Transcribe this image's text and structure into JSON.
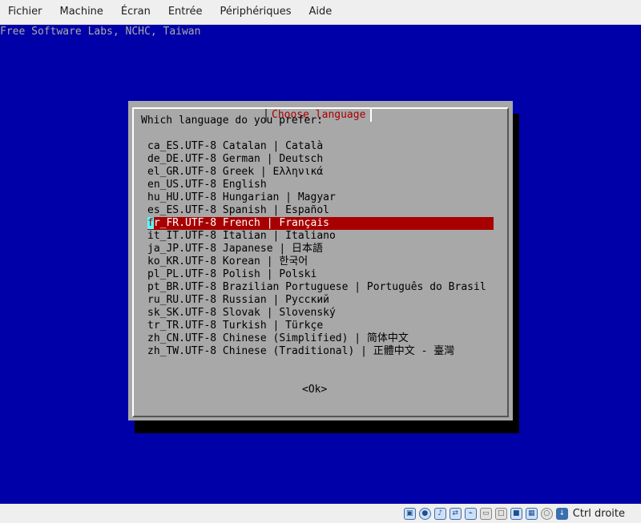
{
  "menubar": {
    "items": [
      "Fichier",
      "Machine",
      "Écran",
      "Entrée",
      "Périphériques",
      "Aide"
    ]
  },
  "screen": {
    "banner": "Free Software Labs, NCHC, Taiwan",
    "dialog": {
      "title": "Choose language",
      "prompt": "Which language do you prefer:",
      "items": [
        "ca_ES.UTF-8 Catalan | Català",
        "de_DE.UTF-8 German | Deutsch",
        "el_GR.UTF-8 Greek | Ελληνικά",
        "en_US.UTF-8 English",
        "hu_HU.UTF-8 Hungarian | Magyar",
        "es_ES.UTF-8 Spanish | Español",
        "fr_FR.UTF-8 French | Français",
        "it_IT.UTF-8 Italian | Italiano",
        "ja_JP.UTF-8 Japanese | 日本語",
        "ko_KR.UTF-8 Korean | 한국어",
        "pl_PL.UTF-8 Polish | Polski",
        "pt_BR.UTF-8 Brazilian Portuguese | Português do Brasil",
        "ru_RU.UTF-8 Russian | Русский",
        "sk_SK.UTF-8 Slovak | Slovenský",
        "tr_TR.UTF-8 Turkish | Türkçe",
        "zh_CN.UTF-8 Chinese (Simplified) | 简体中文",
        "zh_TW.UTF-8 Chinese (Traditional) | 正體中文 - 臺灣"
      ],
      "selected_index": 6,
      "ok_label": "<Ok>"
    }
  },
  "statusbar": {
    "icons": [
      "hard-disk-icon",
      "optical-drive-icon",
      "audio-icon",
      "network-icon",
      "usb-icon",
      "shared-folder-icon",
      "display-icon",
      "video-capture-icon",
      "processor-icon",
      "mouse-integration-icon",
      "host-key-arrow-icon"
    ],
    "host_key_label": "Ctrl droite"
  },
  "colors": {
    "screen_bg": "#0000a8",
    "dialog_bg": "#a8a8a8",
    "title_fg": "#a80000",
    "selection_bg": "#a80000",
    "cursor_bg": "#54fcfc"
  }
}
